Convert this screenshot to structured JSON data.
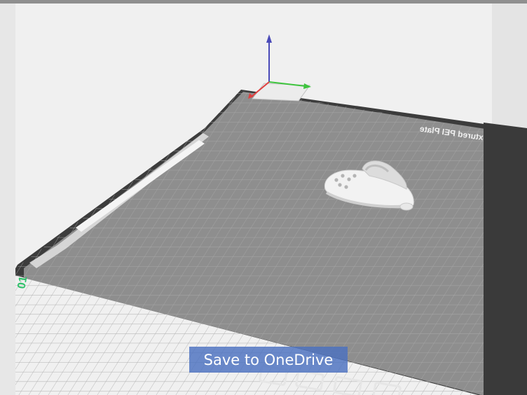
{
  "viewport": {
    "plate_label": "Textured PEI Plate",
    "plate_number": "01",
    "model_name": "clog-shoe"
  },
  "colors": {
    "axis_x": "#e04040",
    "axis_y": "#3ec43e",
    "axis_z": "#4a4ab8",
    "plate": "#8f8f8f",
    "plate_grid": "#a8a8a8",
    "plate_number": "#2ec26a",
    "button": "#4a70c0"
  },
  "toolbar": {
    "save_to_onedrive_label": "Save to OneDrive"
  }
}
